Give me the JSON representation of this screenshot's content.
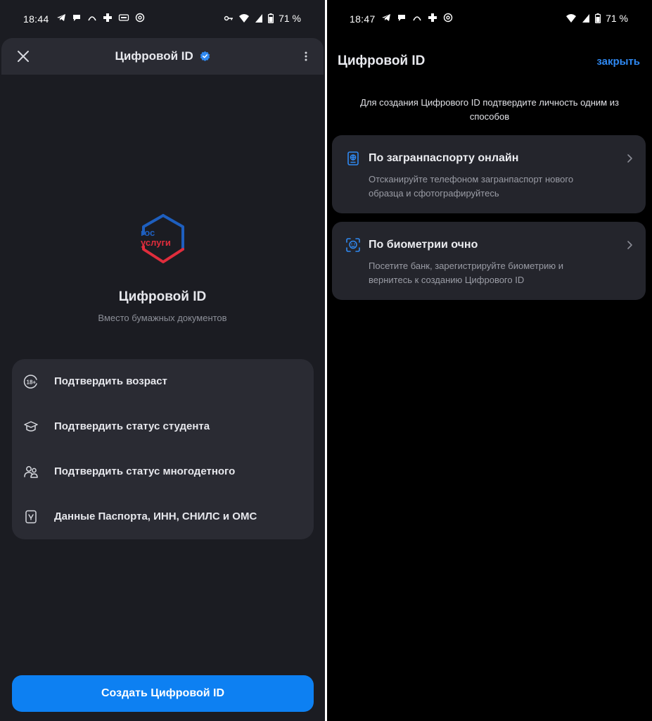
{
  "left": {
    "status": {
      "time": "18:44",
      "battery": "71 %"
    },
    "header": {
      "title": "Цифровой ID"
    },
    "logo": {
      "line1": "гос",
      "line2": "услуги"
    },
    "hero": {
      "title": "Цифровой ID",
      "subtitle": "Вместо бумажных документов"
    },
    "menu": [
      {
        "label": "Подтвердить возраст",
        "icon": "age-18-icon"
      },
      {
        "label": "Подтвердить статус студента",
        "icon": "graduation-cap-icon"
      },
      {
        "label": "Подтвердить статус многодетного",
        "icon": "family-icon"
      },
      {
        "label": "Данные Паспорта, ИНН, СНИЛС и ОМС",
        "icon": "passport-emblem-icon"
      }
    ],
    "create_button": "Создать Цифровой ID"
  },
  "right": {
    "status": {
      "time": "18:47",
      "battery": "71 %"
    },
    "title": "Цифровой ID",
    "close_label": "закрыть",
    "intro": "Для создания Цифрового ID подтвердите личность одним из способов",
    "options": [
      {
        "title": "По загранпаспорту онлайн",
        "description": "Отсканируйте телефоном загранпаспорт нового образца и сфотографируйтесь",
        "icon": "passport-icon"
      },
      {
        "title": "По биометрии очно",
        "description": "Посетите банк, зарегистрируйте биометрию и вернитесь к созданию Цифрового ID",
        "icon": "face-scan-icon"
      }
    ]
  },
  "colors": {
    "accent": "#0d80f2",
    "link": "#2f89f2",
    "verified": "#2f89f2",
    "logo_blue": "#1e5fbf",
    "logo_red": "#e02d3c"
  }
}
